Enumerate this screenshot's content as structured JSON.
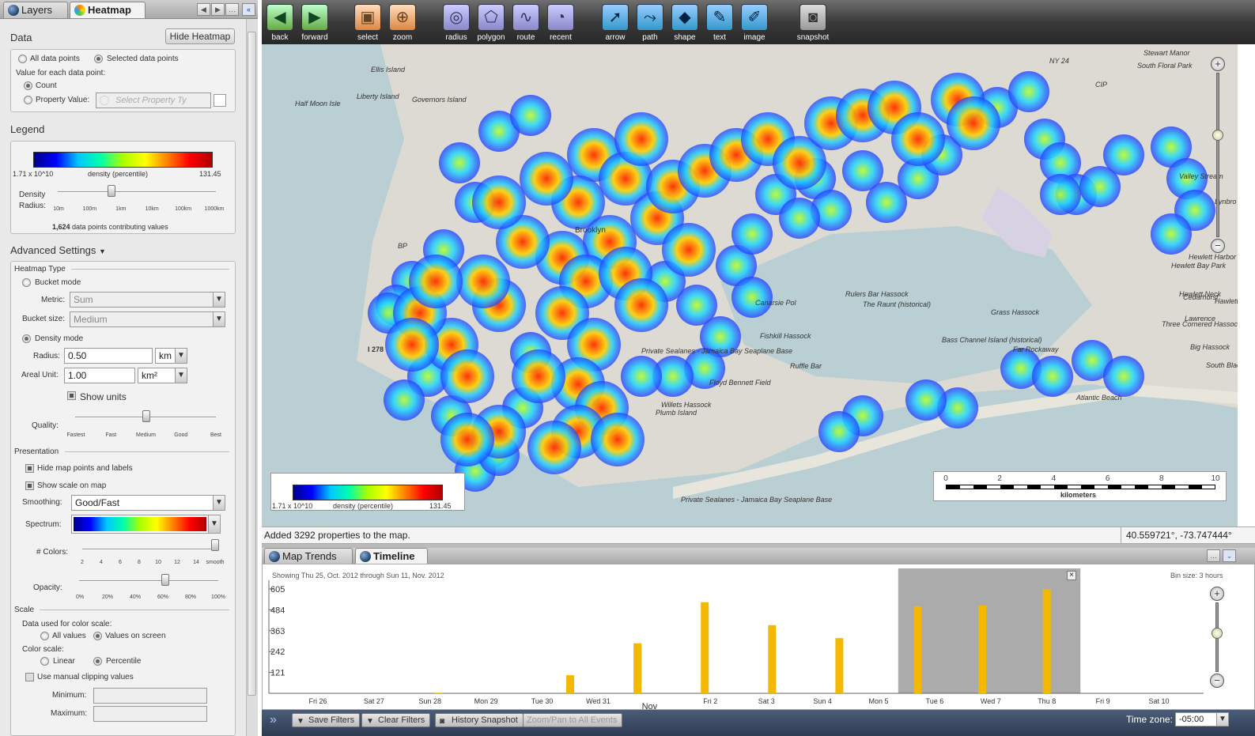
{
  "left_panel": {
    "tabs": [
      {
        "label": "Layers"
      },
      {
        "label": "Heatmap"
      }
    ],
    "data_section": {
      "title": "Data",
      "hide_button": "Hide Heatmap",
      "all_points": "All data points",
      "selected_points": "Selected data points",
      "value_label": "Value for each data point:",
      "count": "Count",
      "property_value": "Property Value:",
      "property_placeholder": "Select Property Ty"
    },
    "legend": {
      "title": "Legend",
      "min": "1.71 x 10^10",
      "label": "density (percentile)",
      "max": "131.45",
      "density_radius_label": "Density\nRadius:",
      "radius_ticks": [
        "10m",
        "100m",
        "1km",
        "10km",
        "100km",
        "1000km"
      ],
      "contributing_count": "1,624",
      "contributing_text": "data points contributing values"
    },
    "advanced": {
      "title": "Advanced Settings",
      "heatmap_type": "Heatmap Type",
      "bucket_mode": "Bucket mode",
      "metric_label": "Metric:",
      "metric_value": "Sum",
      "bucket_size_label": "Bucket size:",
      "bucket_size_value": "Medium",
      "density_mode": "Density mode",
      "radius_label": "Radius:",
      "radius_value": "0.50",
      "radius_unit": "km",
      "areal_label": "Areal Unit:",
      "areal_value": "1.00",
      "areal_unit": "km²",
      "show_units": "Show units",
      "quality_label": "Quality:",
      "quality_ticks": [
        "Fastest",
        "Fast",
        "Medium",
        "Good",
        "Best"
      ],
      "presentation": "Presentation",
      "hide_points": "Hide map points and labels",
      "show_scale": "Show scale on map",
      "smoothing_label": "Smoothing:",
      "smoothing_value": "Good/Fast",
      "spectrum_label": "Spectrum:",
      "colors_label": "# Colors:",
      "colors_ticks": [
        "2",
        "4",
        "6",
        "8",
        "10",
        "12",
        "14",
        "smooth"
      ],
      "opacity_label": "Opacity:",
      "opacity_ticks": [
        "0%",
        "20%",
        "40%",
        "60%",
        "80%",
        "100%"
      ],
      "scale": "Scale",
      "data_used": "Data used for color scale:",
      "all_values": "All values",
      "values_on_screen": "Values on screen",
      "color_scale": "Color scale:",
      "linear": "Linear",
      "percentile": "Percentile",
      "manual_clipping": "Use manual clipping values",
      "minimum": "Minimum:",
      "maximum": "Maximum:"
    }
  },
  "toolbar": {
    "tools": [
      {
        "label": "back",
        "icon": "back-arrow-icon"
      },
      {
        "label": "forward",
        "icon": "forward-arrow-icon"
      },
      {
        "label": "select",
        "icon": "select-icon"
      },
      {
        "label": "zoom",
        "icon": "zoom-icon"
      },
      {
        "label": "radius",
        "icon": "radius-icon"
      },
      {
        "label": "polygon",
        "icon": "polygon-icon"
      },
      {
        "label": "route",
        "icon": "route-icon"
      },
      {
        "label": "recent",
        "icon": "recent-icon"
      },
      {
        "label": "arrow",
        "icon": "arrow-icon"
      },
      {
        "label": "path",
        "icon": "path-icon"
      },
      {
        "label": "shape",
        "icon": "shape-icon"
      },
      {
        "label": "text",
        "icon": "text-icon"
      },
      {
        "label": "image",
        "icon": "image-icon"
      },
      {
        "label": "snapshot",
        "icon": "camera-icon"
      }
    ]
  },
  "map": {
    "labels": [
      "Ellis Island",
      "Half Moon Isle",
      "Liberty Island",
      "Governors Island",
      "Brooklyn",
      "Canarsie Pol",
      "Rulers Bar Hassock",
      "The Raunt (historical)",
      "Fishkill Hassock",
      "Ruffle Bar",
      "Grass Hassock",
      "Bass Channel Island (historical)",
      "Far Rockaway",
      "Willets Hassock",
      "Plumb Island",
      "Floyd Bennett Field",
      "Private Sealanes - Jamaica Bay Seaplane Base",
      "Private Sealanes - Jamaica Bay Seaplane Base",
      "Valley Stream",
      "Cedarhurst",
      "Lawrence",
      "Hewlett Harbor",
      "Hewlett Bay Park",
      "Hewlett Neck",
      "Hawlett Ha",
      "Three Cornered Hassock",
      "Big Hassock",
      "South Black Banks",
      "Atlantic Beach",
      "Stewart Manor",
      "South Floral Park",
      "I 278",
      "CIP",
      "BP",
      "NY 24",
      "Lynbro"
    ],
    "legend_min": "1.71 x 10^10",
    "legend_label": "density (percentile)",
    "legend_max": "131.45",
    "scale_ticks": [
      "0",
      "2",
      "4",
      "6",
      "8",
      "10"
    ],
    "scale_unit": "kilometers"
  },
  "status": {
    "message": "Added 3292 properties to the map.",
    "coords": "40.559721°, -73.747444°"
  },
  "bottom_tabs": [
    {
      "label": "Map Trends"
    },
    {
      "label": "Timeline"
    }
  ],
  "timeline": {
    "range_text": "Showing Thu 25, Oct. 2012 through Sun 11, Nov. 2012",
    "bin_size": "Bin size: 3 hours",
    "month_label": "Nov"
  },
  "chart_data": {
    "type": "bar",
    "categories": [
      "Fri 26",
      "Sat 27",
      "Sun 28",
      "Mon 29",
      "Tue 30",
      "Wed 31",
      "Fri 2",
      "Sat 3",
      "Sun 4",
      "Mon 5",
      "Tue 6",
      "Wed 7",
      "Thu 8",
      "Fri 9",
      "Sat 10",
      "Sun 11"
    ],
    "yticks": [
      121,
      242,
      363,
      484,
      605
    ],
    "ylim": [
      0,
      605
    ],
    "bars": [
      {
        "day": 2.15,
        "value": 3
      },
      {
        "day": 4.5,
        "value": 105
      },
      {
        "day": 5.7,
        "value": 290
      },
      {
        "day": 6.9,
        "value": 528
      },
      {
        "day": 8.1,
        "value": 395
      },
      {
        "day": 9.3,
        "value": 320
      },
      {
        "day": 10.7,
        "value": 505
      },
      {
        "day": 11.85,
        "value": 510
      },
      {
        "day": 13.0,
        "value": 605
      }
    ],
    "bar_color": "#f5b800",
    "selection": [
      10.35,
      13.6
    ],
    "xlabel": "",
    "ylabel": "",
    "title": ""
  },
  "bottom_bar": {
    "save_filters": "Save Filters",
    "clear_filters": "Clear Filters",
    "history_snapshot": "History Snapshot",
    "zoom_pan": "Zoom/Pan to All Events",
    "timezone_label": "Time zone:",
    "timezone_value": "-05:00"
  }
}
